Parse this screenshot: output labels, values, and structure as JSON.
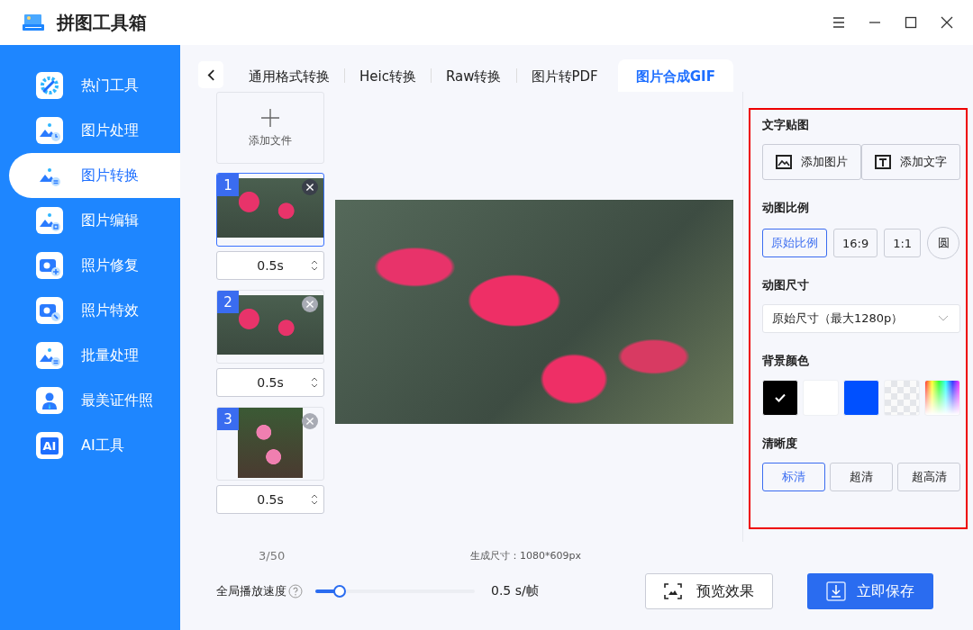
{
  "app": {
    "title": "拼图工具箱"
  },
  "sidebar": {
    "items": [
      {
        "label": "热门工具",
        "selected": false
      },
      {
        "label": "图片处理",
        "selected": false
      },
      {
        "label": "图片转换",
        "selected": true
      },
      {
        "label": "图片编辑",
        "selected": false
      },
      {
        "label": "照片修复",
        "selected": false
      },
      {
        "label": "照片特效",
        "selected": false
      },
      {
        "label": "批量处理",
        "selected": false
      },
      {
        "label": "最美证件照",
        "selected": false
      },
      {
        "label": "AI工具",
        "icon_text": "AI",
        "selected": false
      }
    ]
  },
  "tabs": [
    {
      "label": "通用格式转换",
      "selected": false
    },
    {
      "label": "Heic转换",
      "selected": false
    },
    {
      "label": "Raw转换",
      "selected": false
    },
    {
      "label": "图片转PDF",
      "selected": false
    },
    {
      "label": "图片合成GIF",
      "selected": true
    }
  ],
  "files": {
    "add_label": "添加文件",
    "frames": [
      {
        "number": "1",
        "duration": "0.5s",
        "selected": true
      },
      {
        "number": "2",
        "duration": "0.5s",
        "selected": false
      },
      {
        "number": "3",
        "duration": "0.5s",
        "selected": false
      }
    ]
  },
  "settings": {
    "sticker": {
      "title": "文字贴图",
      "buttons": [
        {
          "label": "添加图片",
          "kind": "image"
        },
        {
          "label": "添加文字",
          "kind": "text"
        }
      ]
    },
    "ratio": {
      "title": "动图比例",
      "options": [
        {
          "label": "原始比例",
          "selected": true,
          "kind": "rect"
        },
        {
          "label": "16:9",
          "selected": false,
          "kind": "rect"
        },
        {
          "label": "1:1",
          "selected": false,
          "kind": "rect"
        },
        {
          "label": "圆",
          "selected": false,
          "kind": "circle"
        }
      ]
    },
    "size": {
      "title": "动图尺寸",
      "value": "原始尺寸（最大1280p）"
    },
    "background": {
      "title": "背景颜色",
      "swatches": [
        {
          "kind": "solid",
          "color": "#000000",
          "selected": true
        },
        {
          "kind": "solid",
          "color": "#ffffff",
          "selected": false
        },
        {
          "kind": "solid",
          "color": "#0050ff",
          "selected": false
        },
        {
          "kind": "transparent",
          "selected": false
        },
        {
          "kind": "spectrum",
          "selected": false
        }
      ]
    },
    "quality": {
      "title": "清晰度",
      "options": [
        {
          "label": "标清",
          "selected": true
        },
        {
          "label": "超清",
          "selected": false
        },
        {
          "label": "超高清",
          "selected": false
        }
      ]
    }
  },
  "footer": {
    "count": "3/50",
    "output_size": "生成尺寸：1080*609px",
    "speed_label": "全局播放速度",
    "speed": {
      "level": 0.17
    },
    "speed_reading": "0.5 s/帧",
    "preview_button": "预览效果",
    "save_button": "立即保存"
  }
}
